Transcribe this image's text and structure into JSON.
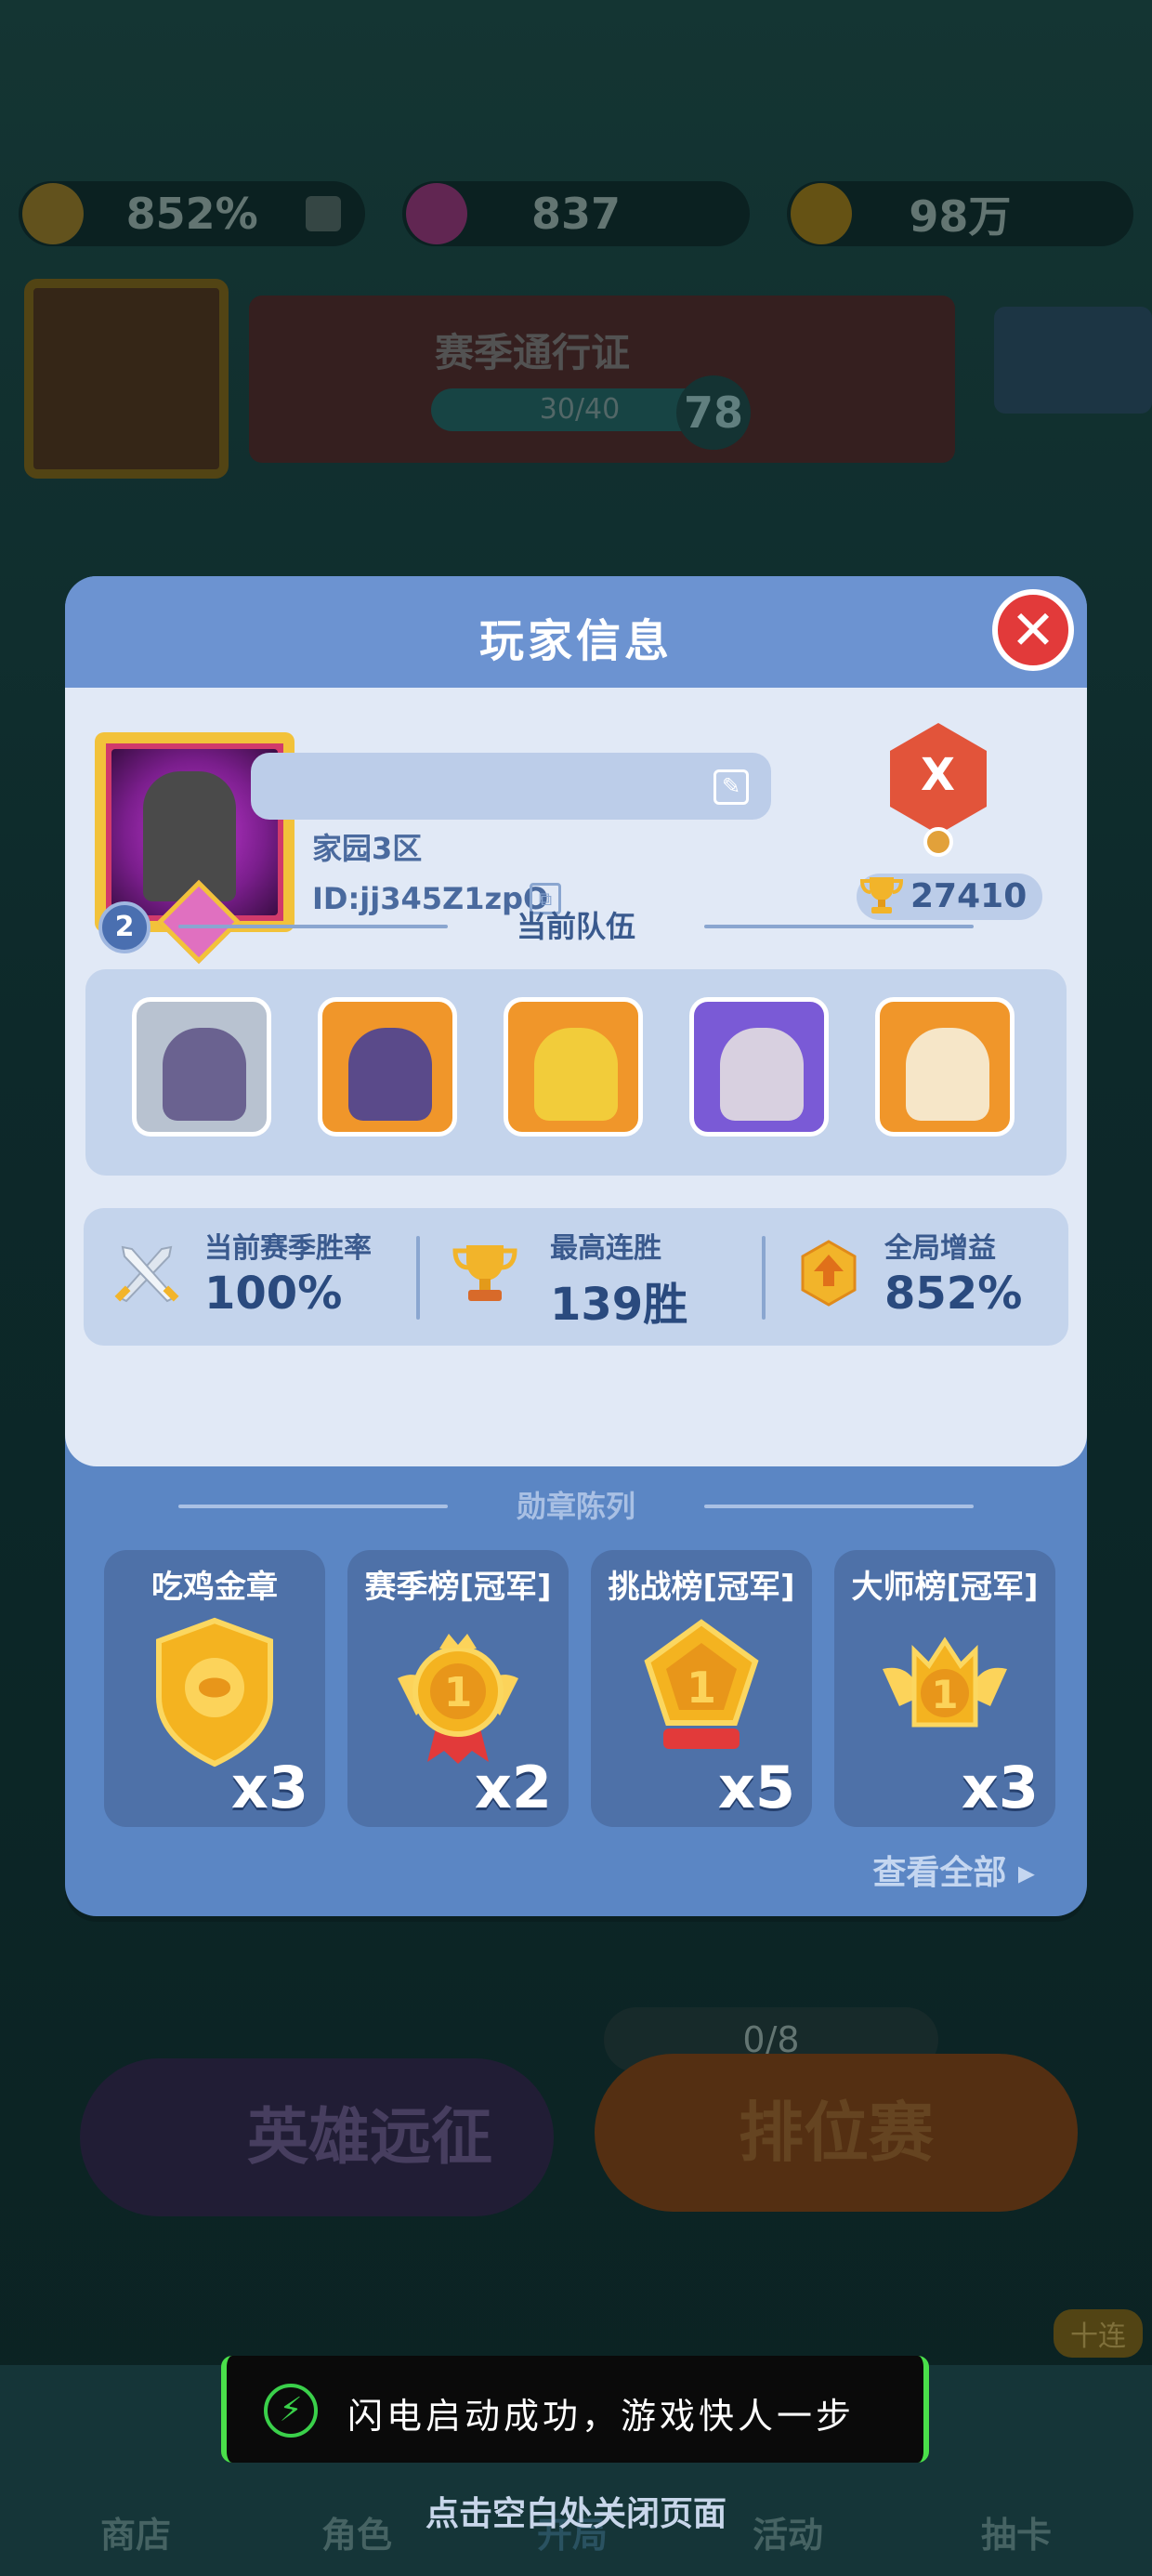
{
  "background": {
    "resources": [
      {
        "icon": "boost-icon",
        "value": "852%"
      },
      {
        "icon": "gem-icon",
        "value": "837"
      },
      {
        "icon": "coin-icon",
        "value": "98万"
      }
    ],
    "season_pass": {
      "title": "赛季通行证",
      "progress": "30/40",
      "level": "78"
    },
    "expedition_label": "英雄远征",
    "ranked_label": "排位赛",
    "ticket_count": "0/8",
    "ten_pull_badge": "十连",
    "nav": [
      "商店",
      "角色",
      "开局",
      "活动",
      "抽卡"
    ]
  },
  "modal": {
    "title": "玩家信息",
    "close_icon": "close-icon",
    "profile": {
      "server": "家园3区",
      "player_id": "ID:jj345Z1zpO",
      "frame_level": "2",
      "rank_letter": "X",
      "trophies": "27410"
    },
    "team_section": "当前队伍",
    "team": [
      {
        "icon": "hero-dark-elf-icon",
        "bg": "#b8c2d0",
        "body": "#6a6290"
      },
      {
        "icon": "hero-tiara-elf-icon",
        "bg": "#f0962a",
        "body": "#5a4a8a"
      },
      {
        "icon": "hero-golden-knight-icon",
        "bg": "#f0962a",
        "body": "#f2cc3a"
      },
      {
        "icon": "hero-masked-mage-icon",
        "bg": "#7a5ad6",
        "body": "#d8d0e0"
      },
      {
        "icon": "hero-angel-icon",
        "bg": "#f0962a",
        "body": "#f6e6c8"
      }
    ],
    "stats": [
      {
        "icon": "crossed-swords-icon",
        "label": "当前赛季胜率",
        "value": "100%"
      },
      {
        "icon": "trophy-icon",
        "label": "最高连胜",
        "value": "139胜"
      },
      {
        "icon": "boost-icon",
        "label": "全局增益",
        "value": "852%"
      }
    ],
    "medal_section": "勋章陈列",
    "medals": [
      {
        "icon": "golden-chicken-medal-icon",
        "title": "吃鸡金章",
        "count": "x3"
      },
      {
        "icon": "season-champion-medal-icon",
        "title": "赛季榜[冠军]",
        "count": "x2"
      },
      {
        "icon": "challenge-champion-medal-icon",
        "title": "挑战榜[冠军]",
        "count": "x5"
      },
      {
        "icon": "master-champion-medal-icon",
        "title": "大师榜[冠军]",
        "count": "x3"
      }
    ],
    "view_all": "查看全部"
  },
  "toast": "闪电启动成功，游戏快人一步",
  "close_hint": "点击空白处关闭页面",
  "colors": {
    "modal": "#5b86c4",
    "card": "#e1e9f6",
    "close": "#e23a3a",
    "gold": "#f2c23a"
  }
}
